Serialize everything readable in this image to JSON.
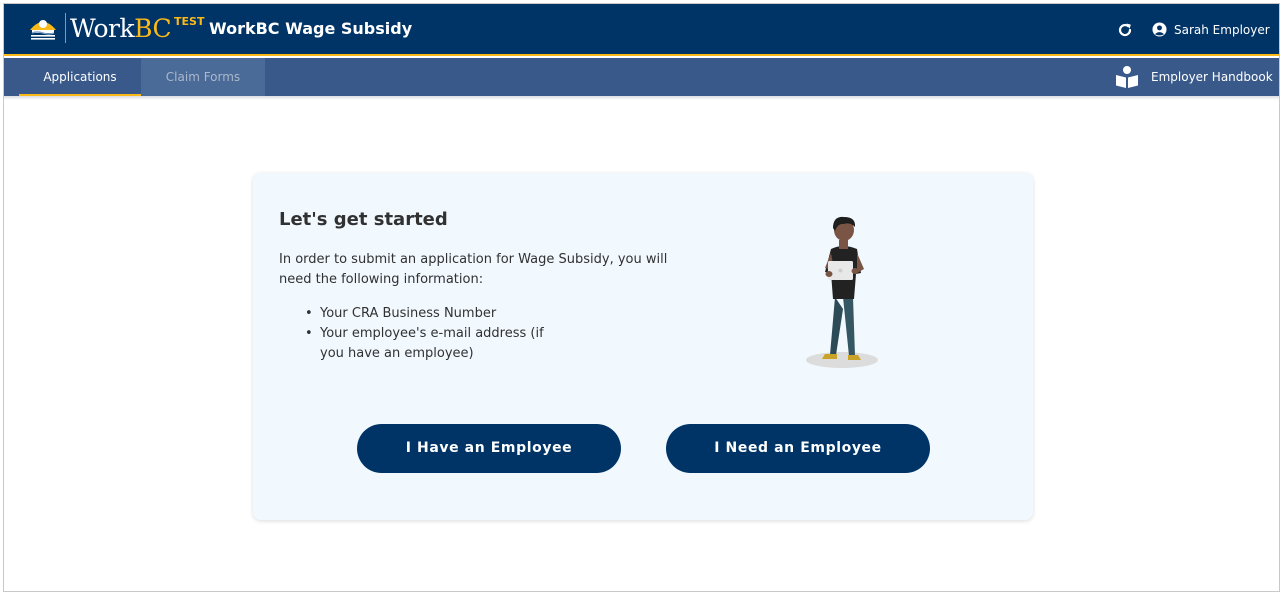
{
  "header": {
    "brand": "Work",
    "brand_accent": "BC",
    "env_badge": "TEST",
    "app_title": "WorkBC Wage Subsidy",
    "user_name": "Sarah Employer",
    "refresh_icon": "refresh-icon",
    "user_icon": "user-circle-icon"
  },
  "nav": {
    "tabs": [
      {
        "label": "Applications",
        "active": true
      },
      {
        "label": "Claim Forms",
        "active": false
      }
    ],
    "handbook_label": "Employer Handbook",
    "handbook_icon": "reading-person-icon"
  },
  "card": {
    "title": "Let's get started",
    "intro": "In order to submit an application for Wage Subsidy, you will need the following information:",
    "requirements": [
      "Your CRA Business Number",
      "Your employee's e-mail address (if you have an employee)"
    ],
    "illustration_icon": "person-with-laptop-illustration"
  },
  "actions": {
    "have_employee": "I Have an Employee",
    "need_employee": "I Need an Employee"
  },
  "colors": {
    "header_bg": "#003366",
    "accent": "#fcba19",
    "nav_bg": "#38598a",
    "card_bg": "#f1f8fe",
    "button_bg": "#003366"
  }
}
